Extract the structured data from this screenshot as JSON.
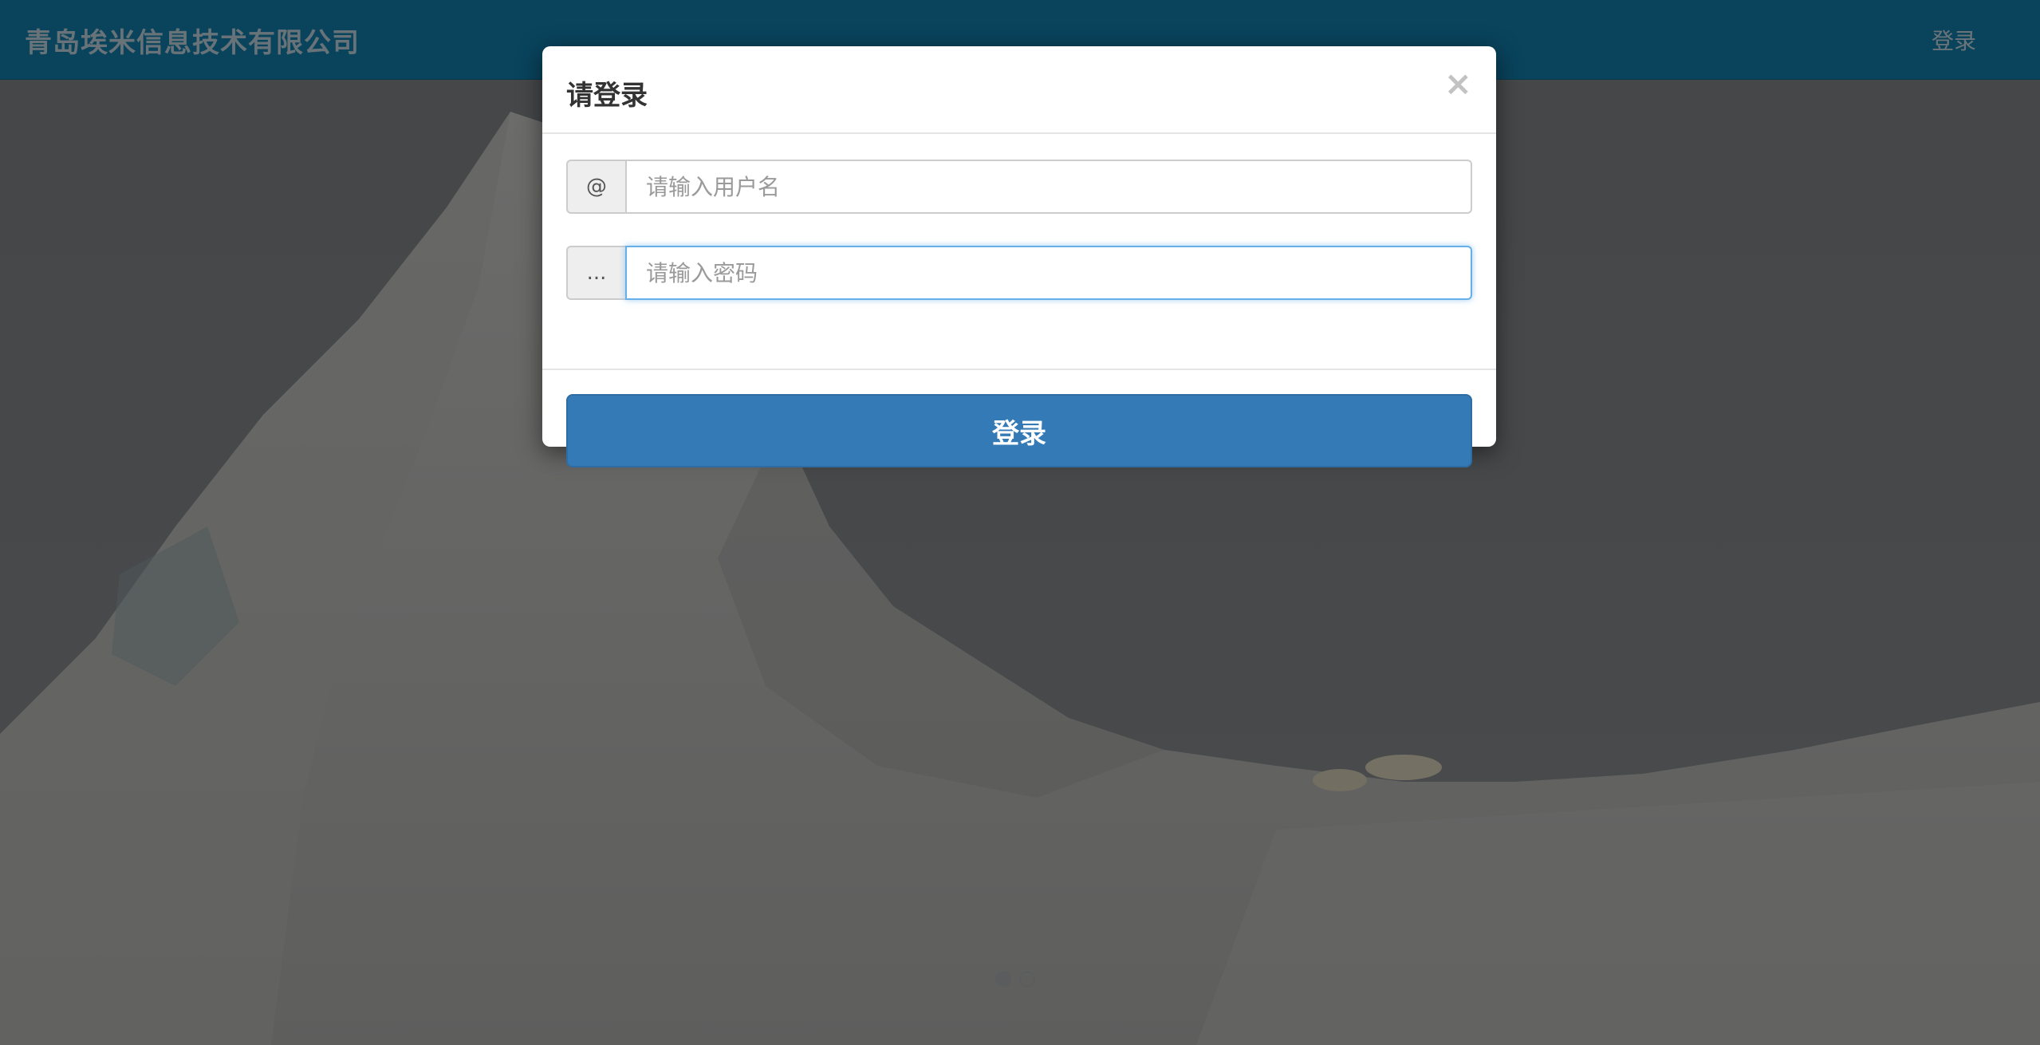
{
  "navbar": {
    "brand": "青岛埃米信息技术有限公司",
    "login_link": "登录"
  },
  "modal": {
    "title": "请登录",
    "close_glyph": "×",
    "username": {
      "addon": "@",
      "placeholder": "请输入用户名",
      "value": ""
    },
    "password": {
      "addon": "...",
      "placeholder": "请输入密码",
      "value": ""
    },
    "submit_label": "登录"
  },
  "carousel": {
    "slide_count": 2,
    "active_index": 0
  },
  "colors": {
    "navbar": "#1387b8",
    "primary_button": "#337ab7",
    "focus_border": "#66afe9"
  }
}
